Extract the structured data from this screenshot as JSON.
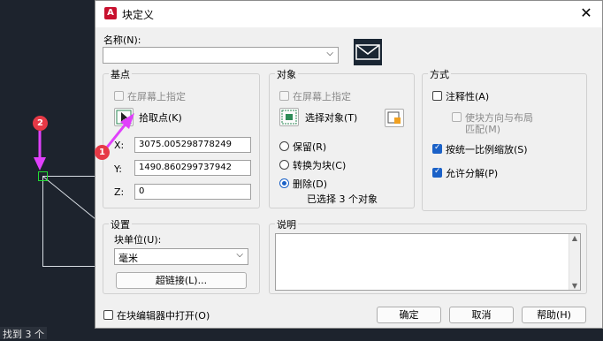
{
  "background": {
    "status_text": "找到 3 个"
  },
  "markers": [
    "1",
    "2"
  ],
  "dialog": {
    "app_icon_text": "A",
    "title": "块定义",
    "close_symbol": "✕",
    "name_label": "名称(N):",
    "name_value": "",
    "base_point": {
      "title": "基点",
      "specify_on_screen": "在屏幕上指定",
      "pick_point": "拾取点(K)",
      "x_label": "X:",
      "x_value": "3075.005298778249",
      "y_label": "Y:",
      "y_value": "1490.860299737942",
      "z_label": "Z:",
      "z_value": "0"
    },
    "objects": {
      "title": "对象",
      "specify_on_screen": "在屏幕上指定",
      "select_objects": "选择对象(T)",
      "retain": "保留(R)",
      "convert_to_block": "转换为块(C)",
      "delete": "删除(D)",
      "selected_count": "已选择 3 个对象"
    },
    "behavior": {
      "title": "方式",
      "annotative": "注释性(A)",
      "match_orientation_1": "使块方向与布局",
      "match_orientation_2": "匹配(M)",
      "scale_uniformly": "按统一比例缩放(S)",
      "allow_exploding": "允许分解(P)"
    },
    "settings": {
      "title": "设置",
      "block_unit_label": "块单位(U):",
      "block_unit_value": "毫米",
      "hyperlink_button": "超链接(L)..."
    },
    "description": {
      "title": "说明"
    },
    "open_in_editor": "在块编辑器中打开(O)",
    "buttons": {
      "ok": "确定",
      "cancel": "取消",
      "help": "帮助(H)"
    }
  },
  "colors": {
    "accent": "#1b61c7",
    "marker": "#e63946",
    "arrow": "#e040fb",
    "canvas": "#1d232d"
  }
}
